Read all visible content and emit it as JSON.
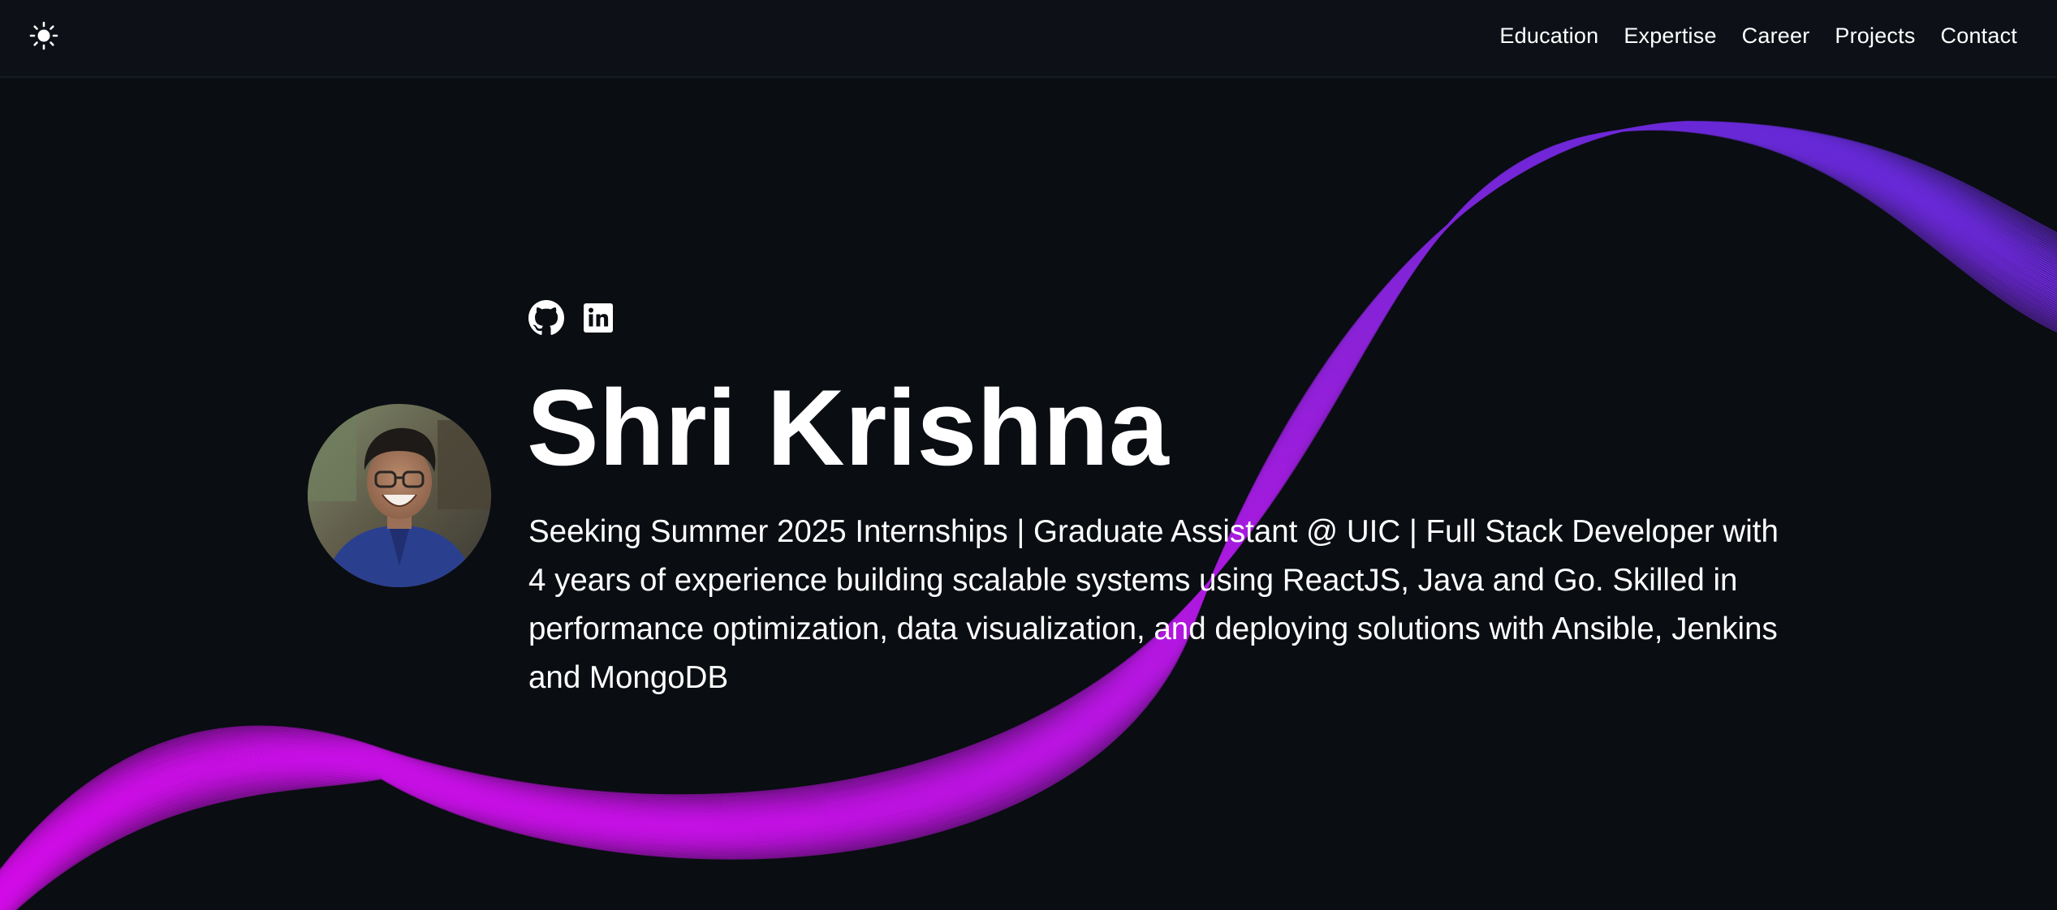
{
  "header": {
    "theme_icon": "sun-icon",
    "nav": [
      {
        "label": "Education"
      },
      {
        "label": "Expertise"
      },
      {
        "label": "Career"
      },
      {
        "label": "Projects"
      },
      {
        "label": "Contact"
      }
    ]
  },
  "hero": {
    "socials": [
      {
        "icon": "github-icon"
      },
      {
        "icon": "linkedin-icon"
      }
    ],
    "name": "Shri Krishna",
    "bio": "Seeking Summer 2025 Internships | Graduate Assistant @ UIC | Full Stack Developer with 4 years of experience building scalable systems using ReactJS, Java and Go. Skilled in performance optimization, data visualization, and deploying solutions with Ansible, Jenkins and MongoDB"
  },
  "colors": {
    "background": "#0a0d12",
    "header_background": "#0d1117",
    "wave_start": "#d20ae6",
    "wave_end": "#5a2bd6",
    "text": "#ffffff"
  }
}
